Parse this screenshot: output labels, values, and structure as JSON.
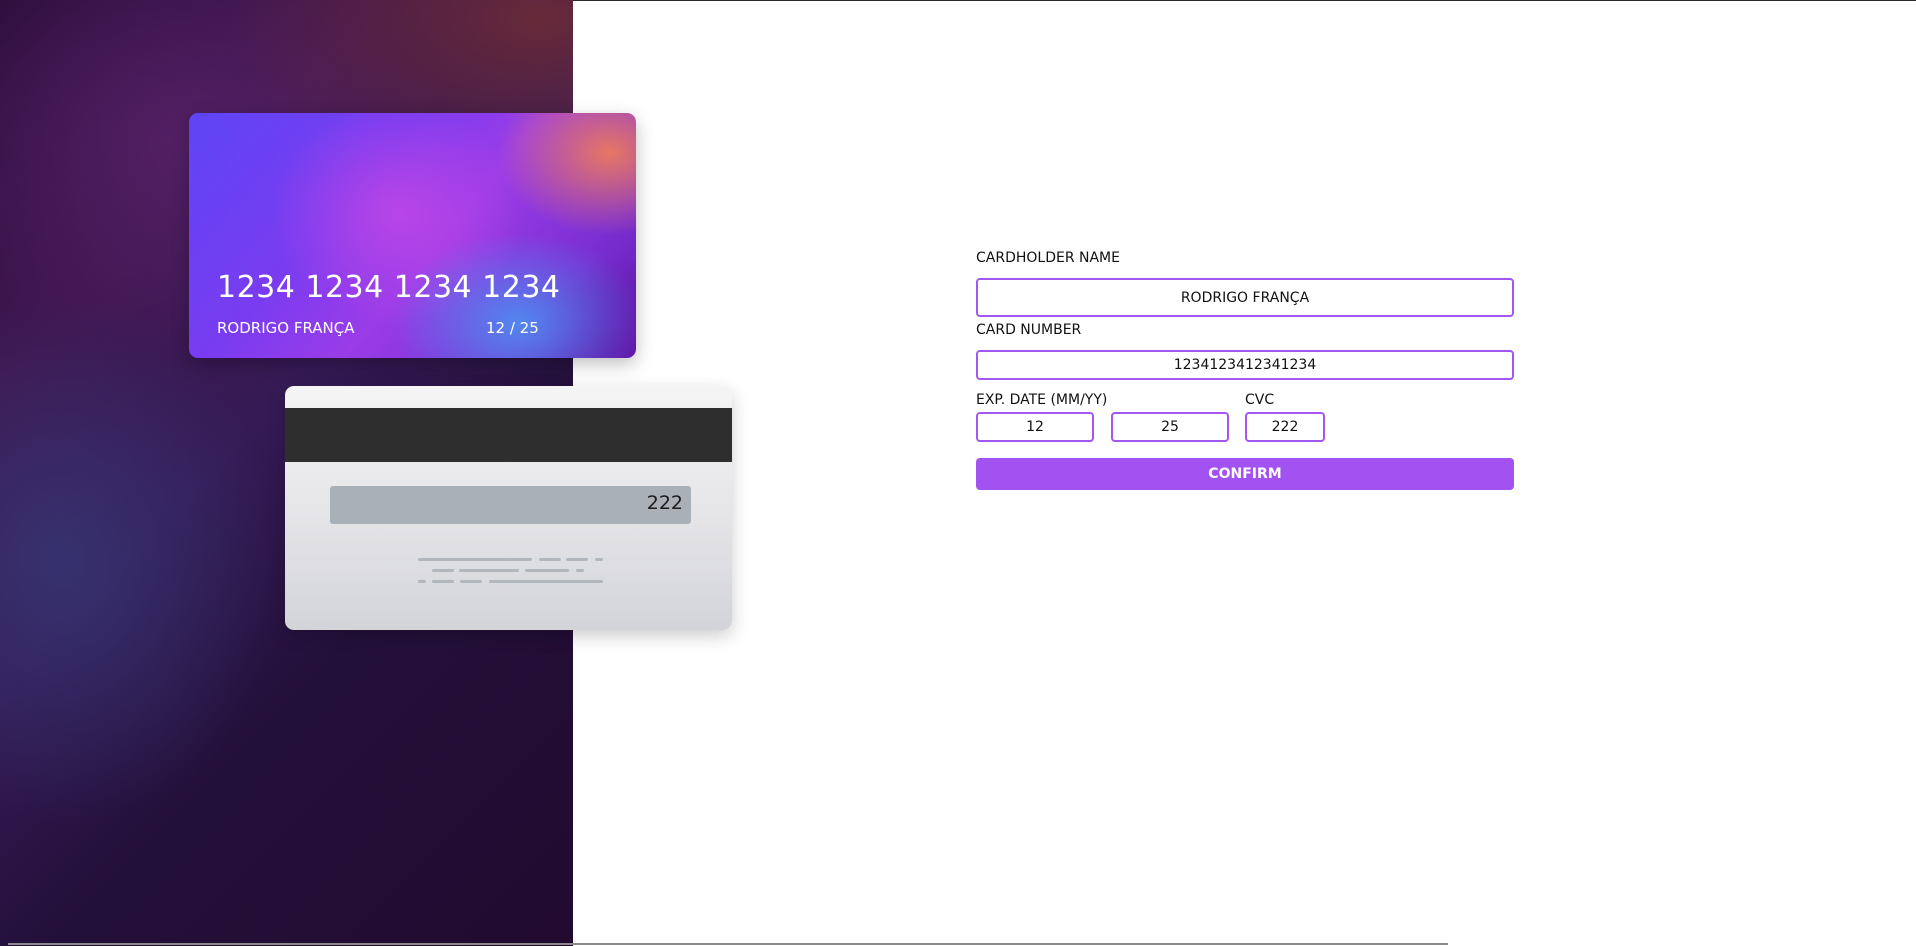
{
  "card_front": {
    "number": "1234 1234 1234 1234",
    "holder": "RODRIGO FRANÇA",
    "expiry": "12 / 25"
  },
  "card_back": {
    "cvc": "222"
  },
  "form": {
    "cardholder_label": "CARDHOLDER NAME",
    "cardholder_value": "RODRIGO FRANÇA",
    "card_number_label": "CARD NUMBER",
    "card_number_value": "1234123412341234",
    "exp_label": "EXP. DATE (MM/YY)",
    "exp_month_value": "12",
    "exp_year_value": "25",
    "cvc_label": "CVC",
    "cvc_value": "222",
    "confirm_label": "CONFIRM"
  },
  "colors": {
    "accent": "#a352f2",
    "input_border": "#a257f2",
    "panel_dark": "#220a2f"
  }
}
